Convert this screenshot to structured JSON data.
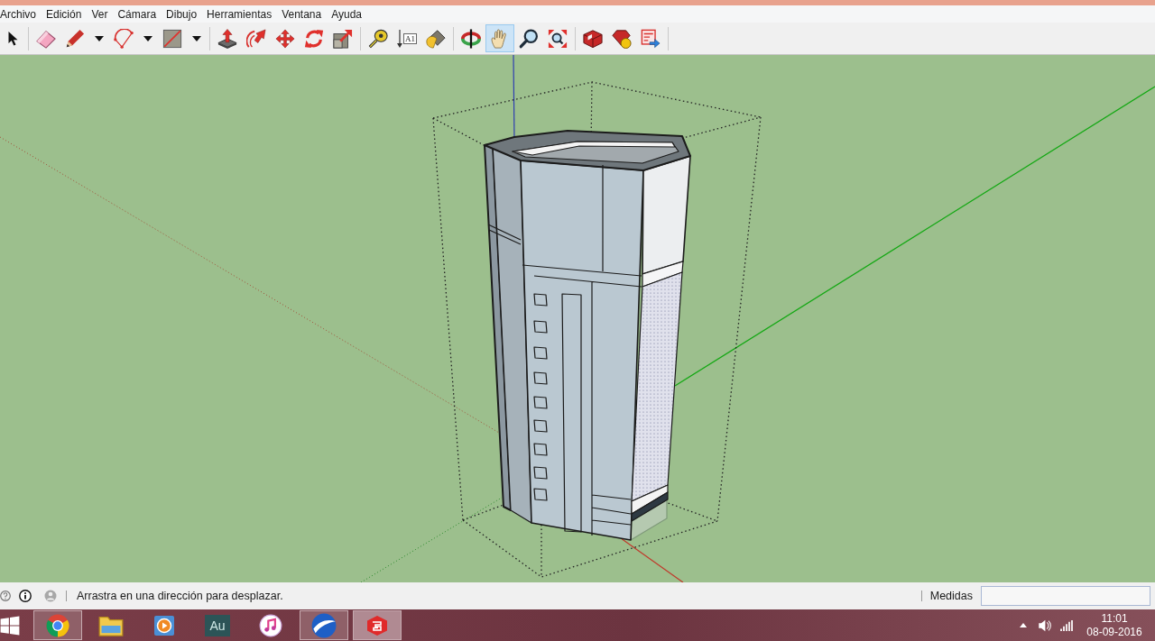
{
  "menu_bar": [
    "Archivo",
    "Edición",
    "Ver",
    "Cámara",
    "Dibujo",
    "Herramientas",
    "Ventana",
    "Ayuda"
  ],
  "toolbar": {
    "groups": [
      {
        "tools": [
          {
            "kind": "select",
            "selected": false,
            "dropdown": false
          }
        ]
      },
      {
        "tools": [
          {
            "kind": "eraser",
            "selected": false,
            "dropdown": false
          },
          {
            "kind": "pencil",
            "selected": false,
            "dropdown": true
          },
          {
            "kind": "arc",
            "selected": false,
            "dropdown": true
          },
          {
            "kind": "rectangle",
            "selected": false,
            "dropdown": true
          }
        ]
      },
      {
        "tools": [
          {
            "kind": "push_pull",
            "selected": false,
            "dropdown": false
          },
          {
            "kind": "follow_me",
            "selected": false,
            "dropdown": false
          },
          {
            "kind": "move",
            "selected": false,
            "dropdown": false
          },
          {
            "kind": "rotate",
            "selected": false,
            "dropdown": false
          },
          {
            "kind": "scale",
            "selected": false,
            "dropdown": false
          }
        ]
      },
      {
        "tools": [
          {
            "kind": "tape_measure",
            "selected": false,
            "dropdown": false
          },
          {
            "kind": "text",
            "label": "A1",
            "selected": false,
            "dropdown": false
          },
          {
            "kind": "paint_bucket",
            "selected": false,
            "dropdown": false
          }
        ]
      },
      {
        "tools": [
          {
            "kind": "orbit",
            "selected": false,
            "dropdown": false
          },
          {
            "kind": "pan",
            "selected": true,
            "dropdown": false
          },
          {
            "kind": "zoom",
            "selected": false,
            "dropdown": false
          },
          {
            "kind": "zoom_extents",
            "selected": false,
            "dropdown": false
          }
        ]
      },
      {
        "tools": [
          {
            "kind": "box",
            "selected": false,
            "dropdown": false
          },
          {
            "kind": "gem",
            "selected": false,
            "dropdown": false
          },
          {
            "kind": "layout_send",
            "selected": false,
            "dropdown": false
          }
        ]
      }
    ]
  },
  "status_bar": {
    "message": "Arrastra en una dirección para desplazar.",
    "measurements_label": "Medidas"
  },
  "taskbar": {
    "apps": [
      {
        "kind": "chrome",
        "running": true,
        "selected": false
      },
      {
        "kind": "folder",
        "running": false,
        "selected": false
      },
      {
        "kind": "media",
        "running": false,
        "selected": false
      },
      {
        "kind": "audition",
        "label": "Au",
        "running": false,
        "selected": false
      },
      {
        "kind": "music",
        "running": false,
        "selected": false
      },
      {
        "kind": "globe",
        "running": true,
        "selected": false
      },
      {
        "kind": "sketch",
        "running": true,
        "selected": true
      }
    ],
    "clock": {
      "time": "11:01",
      "date": "08-09-2016"
    }
  }
}
